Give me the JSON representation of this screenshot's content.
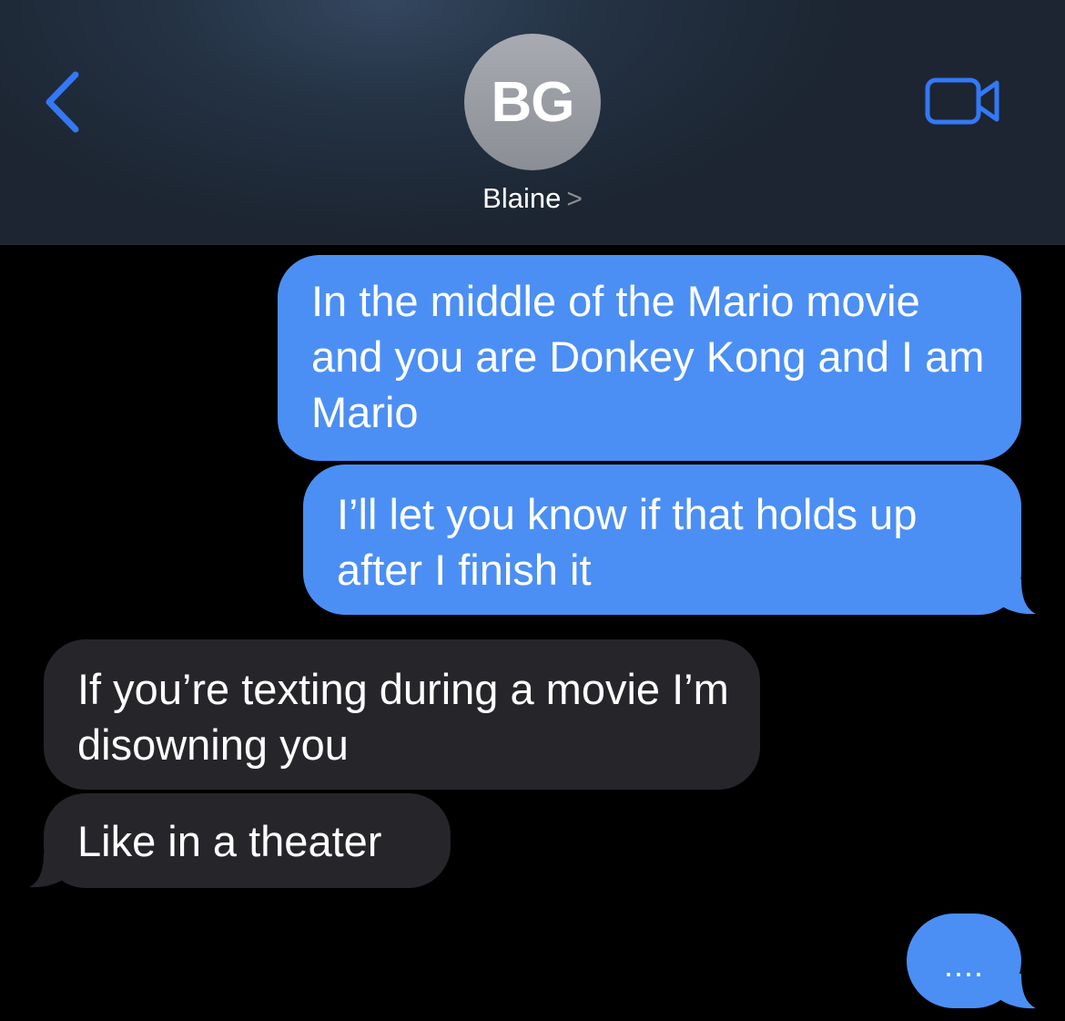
{
  "header": {
    "avatar_initials": "BG",
    "contact_name": "Blaine",
    "contact_chevron": ">",
    "back_icon": "chevron-left-icon",
    "video_icon": "video-camera-icon",
    "accent_color": "#3478f6"
  },
  "messages": [
    {
      "direction": "sent",
      "text": "In the middle of the Mario movie and you are Donkey Kong and I am Mario"
    },
    {
      "direction": "sent",
      "text": "I’ll let you know if that holds up after I finish it"
    },
    {
      "direction": "received",
      "text": "If you’re texting during a movie I’m disowning you"
    },
    {
      "direction": "received",
      "text": "Like in a theater"
    }
  ],
  "typing_indicator": {
    "text": "....",
    "direction": "sent"
  },
  "colors": {
    "sent_bubble": "#4b8ff5",
    "received_bubble": "#26262a",
    "background": "#000000"
  }
}
